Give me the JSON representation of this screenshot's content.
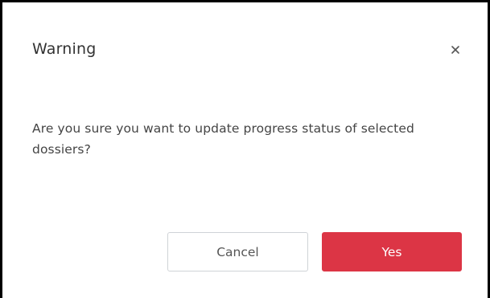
{
  "dialog": {
    "title": "Warning",
    "message": "Are you sure you want to update progress status of selected dossiers?",
    "close_icon": "close-icon",
    "buttons": {
      "cancel_label": "Cancel",
      "confirm_label": "Yes"
    }
  },
  "colors": {
    "confirm_button": "#dc3545",
    "frame_border": "#000000"
  }
}
